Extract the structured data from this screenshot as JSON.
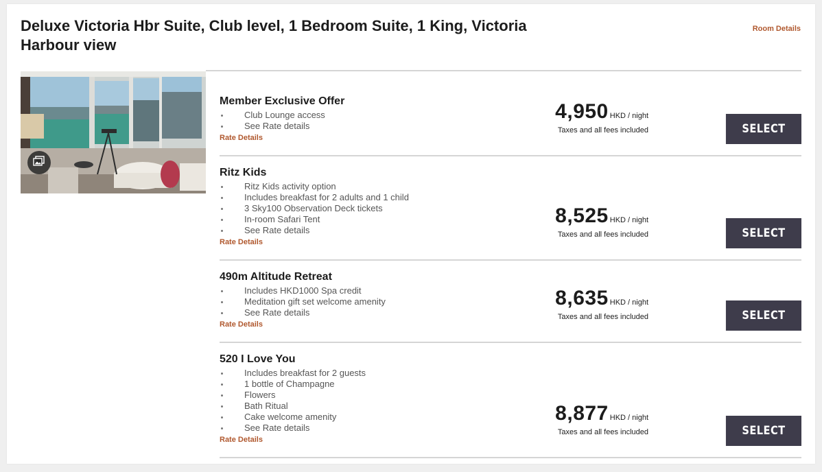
{
  "room": {
    "title": "Deluxe Victoria Hbr Suite, Club level, 1 Bedroom Suite, 1 King, Victoria Harbour view",
    "room_details_label": "Room Details"
  },
  "icons": {
    "gallery": "image-gallery-icon"
  },
  "colors": {
    "link": "#b0582e",
    "button": "#3e3c4b",
    "divider": "#d5d5d5"
  },
  "rates": [
    {
      "name": "Member Exclusive Offer",
      "features": [
        "Club Lounge access",
        "See Rate details"
      ],
      "rate_details_label": "Rate Details",
      "price": "4,950",
      "unit": "HKD / night",
      "note": "Taxes and all fees included",
      "button_label": "SELECT"
    },
    {
      "name": "Ritz Kids",
      "features": [
        "Ritz Kids activity option",
        "Includes breakfast for 2 adults and 1 child",
        "3 Sky100 Observation Deck tickets",
        "In-room Safari Tent",
        "See Rate details"
      ],
      "rate_details_label": "Rate Details",
      "price": "8,525",
      "unit": "HKD / night",
      "note": "Taxes and all fees included",
      "button_label": "SELECT"
    },
    {
      "name": "490m Altitude Retreat",
      "features": [
        "Includes HKD1000 Spa credit",
        "Meditation gift set welcome amenity",
        "See Rate details"
      ],
      "rate_details_label": "Rate Details",
      "price": "8,635",
      "unit": "HKD / night",
      "note": "Taxes and all fees included",
      "button_label": "SELECT"
    },
    {
      "name": "520 I Love You",
      "features": [
        "Includes breakfast for 2 guests",
        "1 bottle of Champagne",
        "Flowers",
        "Bath Ritual",
        "Cake welcome amenity",
        "See Rate details"
      ],
      "rate_details_label": "Rate Details",
      "price": "8,877",
      "unit": "HKD / night",
      "note": "Taxes and all fees included",
      "button_label": "SELECT"
    }
  ]
}
